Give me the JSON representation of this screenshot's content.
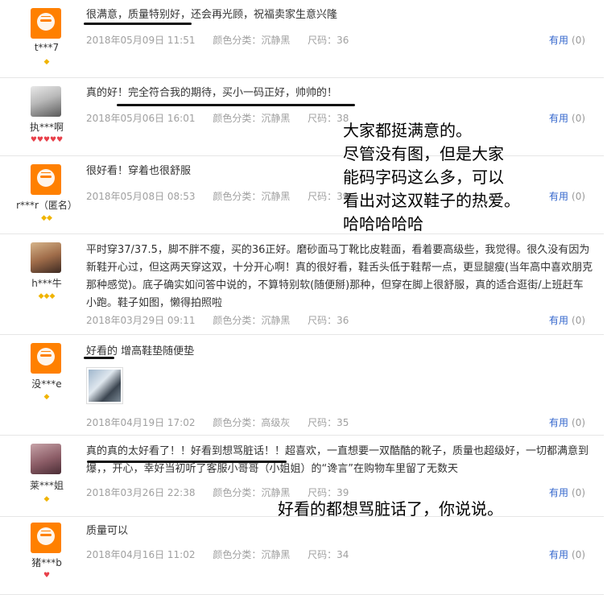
{
  "reviews": [
    {
      "user": "t***7",
      "badges": "gem1",
      "content": "很满意，质量特别好，还会再光顾，祝福卖家生意兴隆",
      "date": "2018年05月09日 11:51",
      "color": "颜色分类：沉静黑",
      "size": "尺码：36",
      "useful_label": "有用",
      "useful_count": "(0)"
    },
    {
      "user": "执***啊",
      "badges": "heart5",
      "content": "真的好！完全符合我的期待，买小一码正好，帅帅的！",
      "date": "2018年05月06日 16:01",
      "color": "颜色分类：沉静黑",
      "size": "尺码：38",
      "useful_label": "有用",
      "useful_count": "(0)"
    },
    {
      "user": "r***r（匿名）",
      "badges": "gem2",
      "content": "很好看！穿着也很舒服",
      "date": "2018年05月08日 08:53",
      "color": "颜色分类：沉静黑",
      "size": "尺码：39",
      "useful_label": "有用",
      "useful_count": "(0)"
    },
    {
      "user": "h***牛",
      "badges": "gem3",
      "content": "平时穿37/37.5，脚不胖不瘦，买的36正好。磨砂面马丁靴比皮鞋面，看着要高级些，我觉得。很久没有因为新鞋开心过，但这两天穿这双，十分开心啊！真的很好看，鞋舌头低于鞋帮一点，更显腿瘦(当年高中喜欢朋克那种感觉)。底子确实如问答中说的，不算特别软(随便掰)那种，但穿在脚上很舒服，真的适合逛街/上班赶车小跑。鞋子如图，懒得拍照啦",
      "date": "2018年03月29日 09:11",
      "color": "颜色分类：沉静黑",
      "size": "尺码：36",
      "useful_label": "有用",
      "useful_count": "(0)"
    },
    {
      "user": "没***e",
      "badges": "gem1",
      "content": "好看的 增高鞋垫随便垫",
      "date": "2018年04月19日 17:02",
      "color": "颜色分类：高级灰",
      "size": "尺码：35",
      "useful_label": "有用",
      "useful_count": "(0)"
    },
    {
      "user": "莱***姐",
      "badges": "gem1",
      "content": "真的真的太好看了！！好看到想骂脏话！！超喜欢，一直想要一双酷酷的靴子，质量也超级好，一切都满意到爆，，开心，幸好当初听了客服小哥哥（小姐姐）的“谗言”在购物车里留了无数天",
      "date": "2018年03月26日 22:38",
      "color": "颜色分类：沉静黑",
      "size": "尺码：39",
      "useful_label": "有用",
      "useful_count": "(0)"
    },
    {
      "user": "猪***b",
      "badges": "heart1",
      "content": "质量可以",
      "date": "2018年04月16日 11:02",
      "color": "颜色分类：沉静黑",
      "size": "尺码：34",
      "useful_label": "有用",
      "useful_count": "(0)"
    }
  ],
  "annotations": {
    "line1": "大家都挺满意的。",
    "line2": "尽管没有图，但是大家",
    "line3": "能码字码这么多，可以",
    "line4": "看出对这双鞋子的热爱。",
    "line5": "哈哈哈哈哈",
    "line6": "好看的都想骂脏话了，你说说。"
  }
}
